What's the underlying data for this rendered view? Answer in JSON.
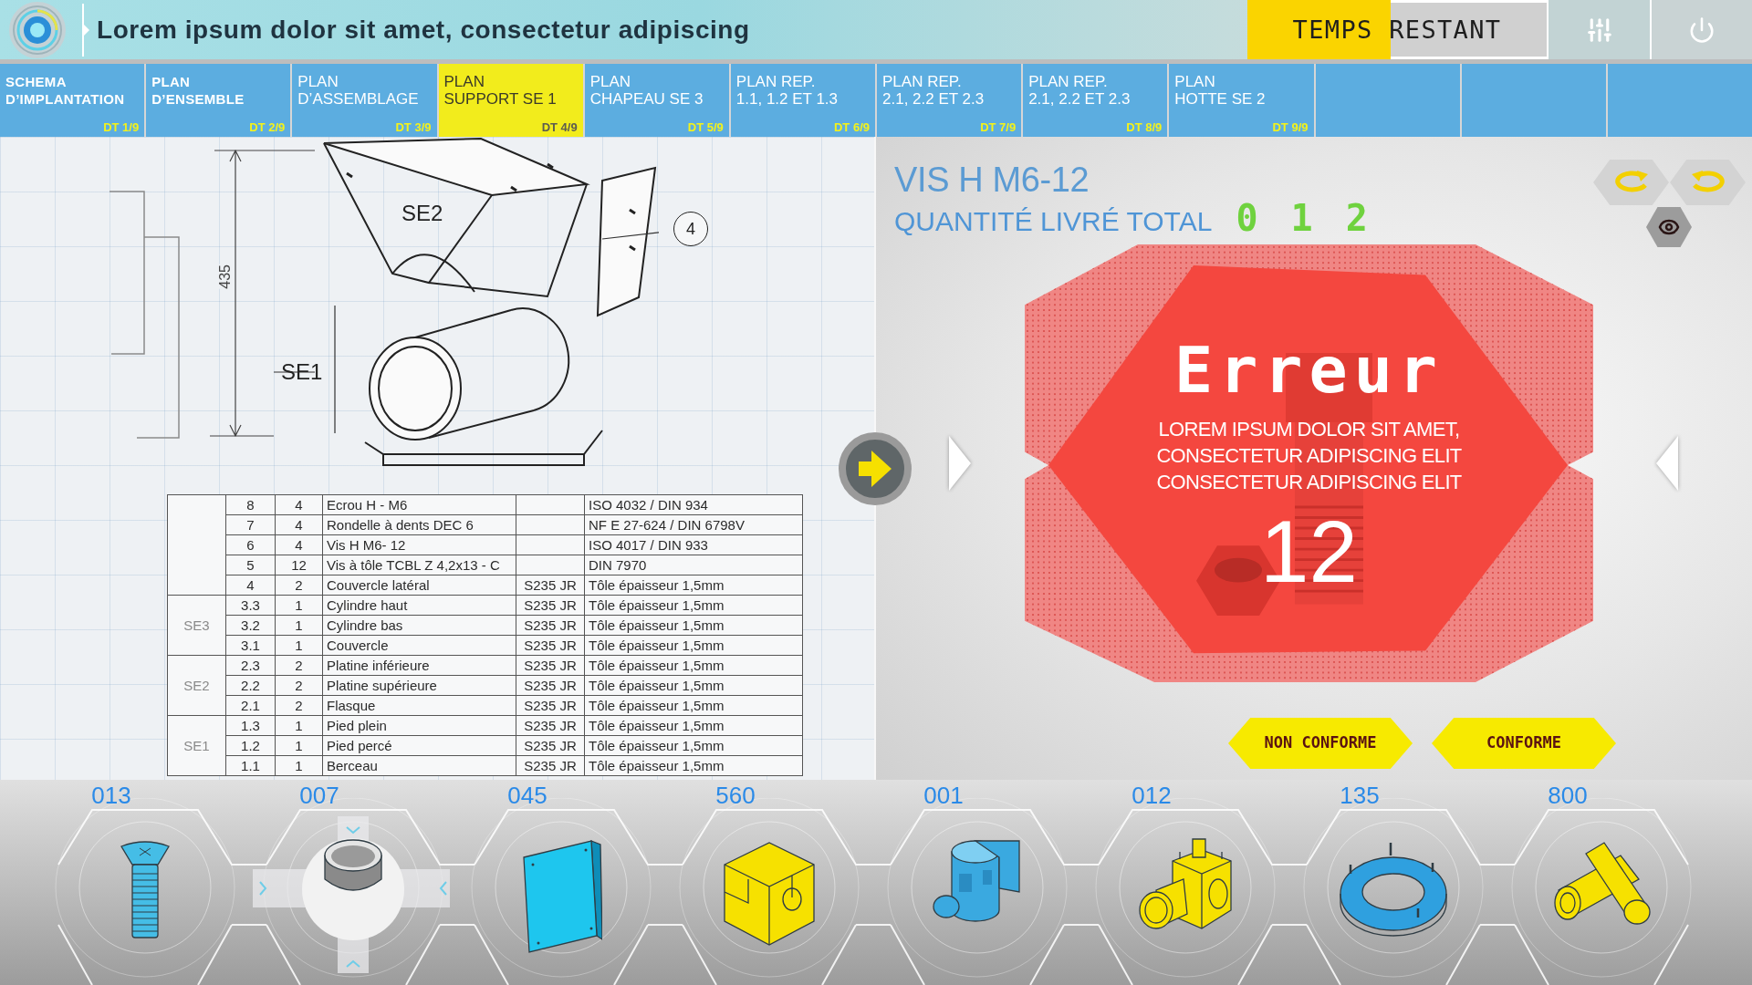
{
  "header": {
    "title": "Lorem ipsum dolor sit amet, consectetur adipiscing"
  },
  "timer": {
    "label": "TEMPS RESTANT",
    "level": 0.48
  },
  "tabs": [
    {
      "lines": [
        "SCHEMA",
        "D’IMPLANTATION"
      ],
      "code": "DT 1/9",
      "bold": true,
      "selected": false
    },
    {
      "lines": [
        "PLAN",
        "D’ENSEMBLE"
      ],
      "code": "DT 2/9",
      "bold": true,
      "selected": false
    },
    {
      "lines": [
        "PLAN",
        "D’ASSEMBLAGE"
      ],
      "code": "DT 3/9",
      "bold": false,
      "selected": false
    },
    {
      "lines": [
        "PLAN",
        "SUPPORT SE 1"
      ],
      "code": "DT 4/9",
      "bold": false,
      "selected": true
    },
    {
      "lines": [
        "PLAN",
        "CHAPEAU SE 3"
      ],
      "code": "DT 5/9",
      "bold": false,
      "selected": false
    },
    {
      "lines": [
        "PLAN REP.",
        "1.1, 1.2 ET 1.3"
      ],
      "code": "DT 6/9",
      "bold": false,
      "selected": false
    },
    {
      "lines": [
        "PLAN REP.",
        "2.1, 2.2 ET 2.3"
      ],
      "code": "DT 7/9",
      "bold": false,
      "selected": false
    },
    {
      "lines": [
        "PLAN REP.",
        "2.1, 2.2 ET 2.3"
      ],
      "code": "DT 8/9",
      "bold": false,
      "selected": false
    },
    {
      "lines": [
        "PLAN",
        "HOTTE SE 2"
      ],
      "code": "DT 9/9",
      "bold": false,
      "selected": false
    },
    {
      "selected": false
    },
    {
      "selected": false
    },
    {
      "selected": false
    }
  ],
  "drawing": {
    "labels": [
      "SE2",
      "SE1"
    ],
    "callout": "4",
    "dimension": "435"
  },
  "table": {
    "sections": [
      {
        "rows": [
          {
            "rep": "8",
            "qty": "4",
            "designation": "Ecrou H - M6",
            "observation": "ISO 4032 / DIN 934"
          },
          {
            "rep": "7",
            "qty": "4",
            "designation": "Rondelle à dents DEC 6",
            "observation": "NF E 27-624 / DIN 6798V"
          },
          {
            "rep": "6",
            "qty": "4",
            "designation": "Vis H M6- 12",
            "observation": "ISO 4017 / DIN 933"
          },
          {
            "rep": "5",
            "qty": "12",
            "designation": "Vis à tôle TCBL Z 4,2x13 - C",
            "observation": "DIN 7970"
          },
          {
            "rep": "4",
            "qty": "2",
            "designation": "Couvercle latéral",
            "material": "S235 JR",
            "observation": "Tôle épaisseur 1,5mm"
          }
        ]
      },
      {
        "label": "SE3",
        "rows": [
          {
            "rep": "3.3",
            "qty": "1",
            "designation": "Cylindre haut",
            "material": "S235 JR",
            "observation": "Tôle épaisseur 1,5mm"
          },
          {
            "rep": "3.2",
            "qty": "1",
            "designation": "Cylindre bas",
            "material": "S235 JR",
            "observation": "Tôle épaisseur 1,5mm"
          },
          {
            "rep": "3.1",
            "qty": "1",
            "designation": "Couvercle",
            "material": "S235 JR",
            "observation": "Tôle épaisseur 1,5mm"
          }
        ]
      },
      {
        "label": "SE2",
        "rows": [
          {
            "rep": "2.3",
            "qty": "2",
            "designation": "Platine inférieure",
            "material": "S235 JR",
            "observation": "Tôle épaisseur 1,5mm"
          },
          {
            "rep": "2.2",
            "qty": "2",
            "designation": "Platine supérieure",
            "material": "S235 JR",
            "observation": "Tôle épaisseur 1,5mm"
          },
          {
            "rep": "2.1",
            "qty": "2",
            "designation": "Flasque",
            "material": "S235 JR",
            "observation": "Tôle épaisseur 1,5mm"
          }
        ]
      },
      {
        "label": "SE1",
        "rows": [
          {
            "rep": "1.3",
            "qty": "1",
            "designation": "Pied plein",
            "material": "S235 JR",
            "observation": "Tôle épaisseur 1,5mm"
          },
          {
            "rep": "1.2",
            "qty": "1",
            "designation": "Pied percé",
            "material": "S235 JR",
            "observation": "Tôle épaisseur 1,5mm"
          },
          {
            "rep": "1.1",
            "qty": "1",
            "designation": "Berceau",
            "material": "S235 JR",
            "observation": "Tôle épaisseur 1,5mm"
          }
        ]
      }
    ]
  },
  "part": {
    "name": "VIS H M6-12",
    "quantity_label": "QUANTITÉ LIVRÉ TOTAL",
    "quantity": "0 1 2"
  },
  "alert": {
    "title": "Erreur",
    "lines": [
      "LOREM IPSUM DOLOR SIT AMET,",
      "CONSECTETUR ADIPISCING ELIT",
      "CONSECTETUR ADIPISCING ELIT"
    ],
    "count": "12"
  },
  "actions": [
    "NON CONFORME",
    "CONFORME"
  ],
  "parts": [
    {
      "number": "013",
      "kind": "screw",
      "color": "#45bde6",
      "selected": false
    },
    {
      "number": "007",
      "kind": "pipe",
      "color": "#8a8a8a",
      "selected": true
    },
    {
      "number": "045",
      "kind": "plate",
      "color": "#1ec6ee",
      "selected": false
    },
    {
      "number": "560",
      "kind": "block",
      "color": "#f6e100",
      "selected": false
    },
    {
      "number": "001",
      "kind": "bracket",
      "color": "#3aa9e0",
      "selected": false
    },
    {
      "number": "012",
      "kind": "tee",
      "color": "#f6e100",
      "selected": false
    },
    {
      "number": "135",
      "kind": "ring",
      "color": "#2fa0df",
      "selected": false
    },
    {
      "number": "800",
      "kind": "cross",
      "color": "#f6e100",
      "selected": false
    }
  ]
}
